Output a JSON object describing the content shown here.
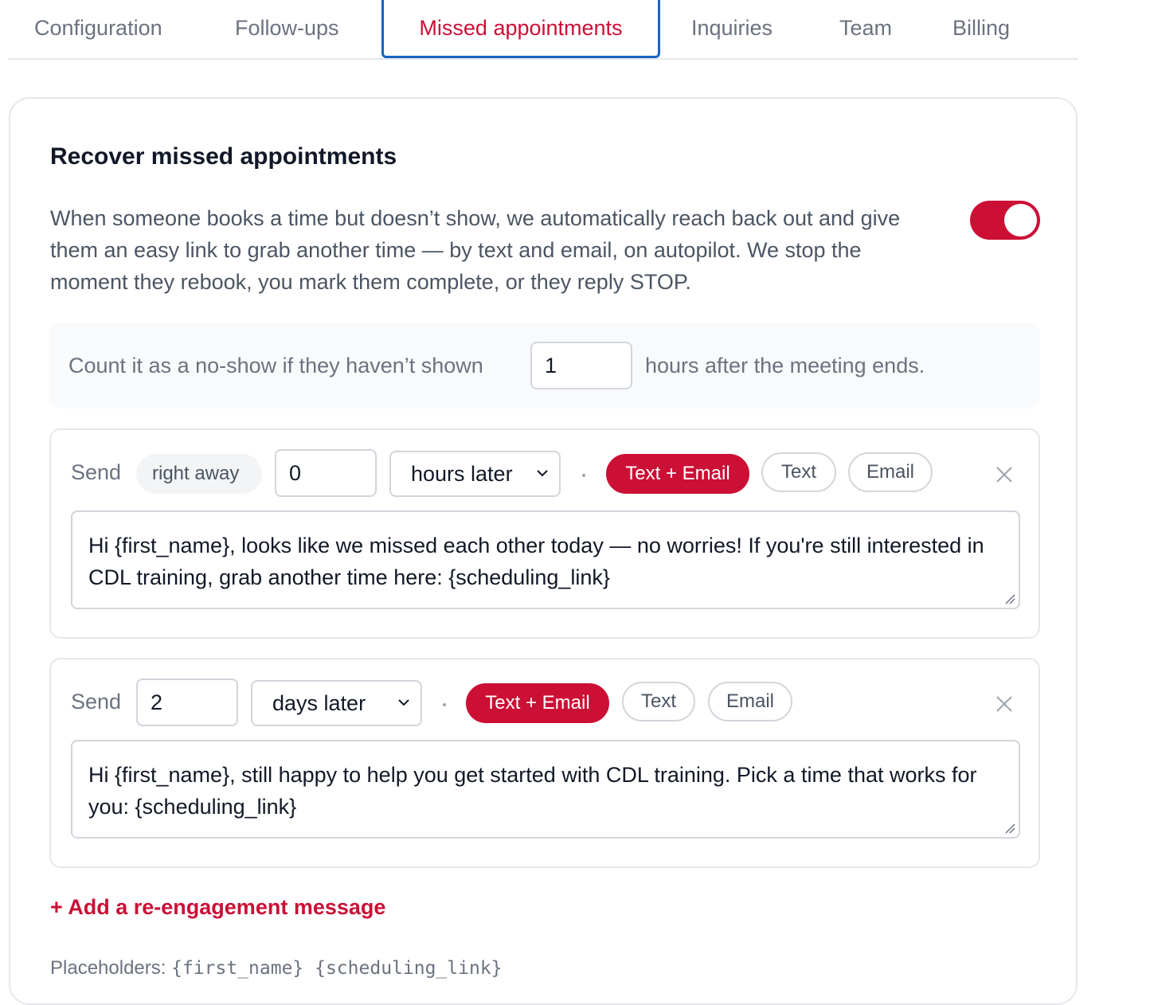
{
  "tabs": [
    {
      "label": "Configuration"
    },
    {
      "label": "Follow-ups"
    },
    {
      "label": "Missed appointments"
    },
    {
      "label": "Inquiries"
    },
    {
      "label": "Team"
    },
    {
      "label": "Billing"
    }
  ],
  "active_tab": "Missed appointments",
  "card": {
    "title": "Recover missed appointments",
    "description": "When someone books a time but doesn’t show, we automatically reach back out and give them an easy link to grab another time — by text and email, on autopilot. We stop the moment they rebook, you mark them complete, or they reply STOP.",
    "enabled": true,
    "noshow": {
      "prefix": "Count it as a no-show if they haven’t shown",
      "hours_value": "1",
      "suffix": "hours after the meeting ends."
    }
  },
  "steps": [
    {
      "send_label": "Send",
      "right_away_label": "right away",
      "delay_value": "0",
      "unit_label": "hours later",
      "channels": [
        "Text + Email",
        "Text",
        "Email"
      ],
      "selected_channel": "Text + Email",
      "message": "Hi {first_name}, looks like we missed each other today — no worries! If you're still interested in CDL training, grab another time here: {scheduling_link}"
    },
    {
      "send_label": "Send",
      "delay_value": "2",
      "unit_label": "days later",
      "channels": [
        "Text + Email",
        "Text",
        "Email"
      ],
      "selected_channel": "Text + Email",
      "message": "Hi {first_name}, still happy to help you get started with CDL training. Pick a time that works for you: {scheduling_link}"
    }
  ],
  "add_message_label": "+ Add a re-engagement message",
  "placeholders": {
    "label": "Placeholders:",
    "items": "{first_name} {scheduling_link}"
  },
  "colors": {
    "accent": "#cc0f35",
    "tab_focus": "#1765c0",
    "muted_text": "#6b7280"
  },
  "icons": {
    "close": "close-icon",
    "dropdown": "chevron-down-icon"
  }
}
